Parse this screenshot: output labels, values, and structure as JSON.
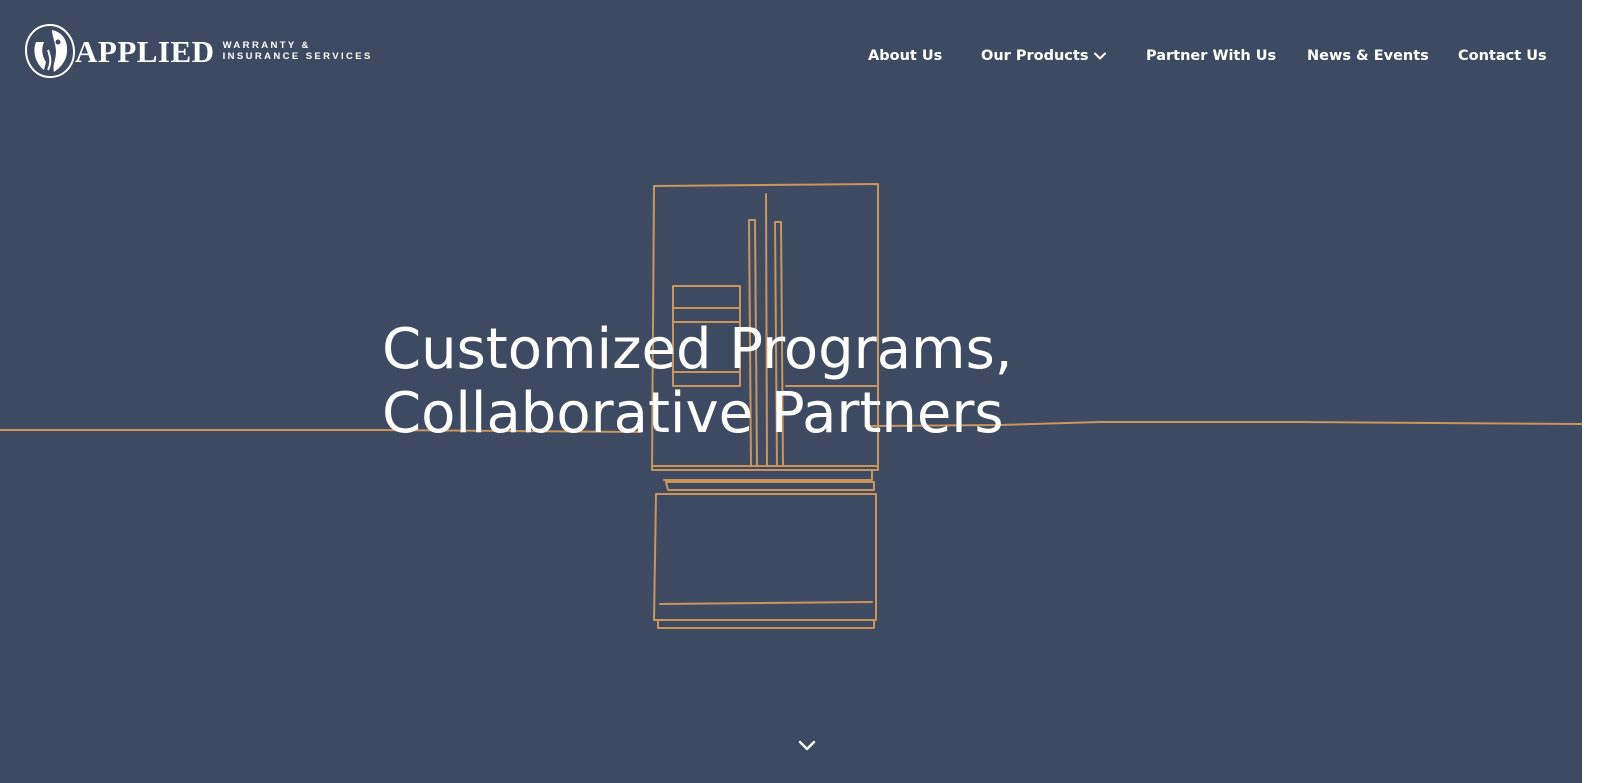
{
  "colors": {
    "hero_background": "#3d4a61",
    "line_art": "#c8955a",
    "text": "#ffffff"
  },
  "logo": {
    "name": "APPLIED",
    "tagline_line1": "WARRANTY &",
    "tagline_line2": "INSURANCE SERVICES"
  },
  "nav": {
    "items": [
      {
        "label": "About Us"
      },
      {
        "label": "Our Products",
        "icon": "chevron-down-icon"
      },
      {
        "label": "Partner With Us"
      },
      {
        "label": "News & Events"
      },
      {
        "label": "Contact Us"
      }
    ]
  },
  "hero": {
    "headline_line1": "Customized Programs,",
    "headline_line2": "Collaborative Partners",
    "illustration": "refrigerator-line-art-icon",
    "scroll_icon": "chevron-down-icon"
  }
}
